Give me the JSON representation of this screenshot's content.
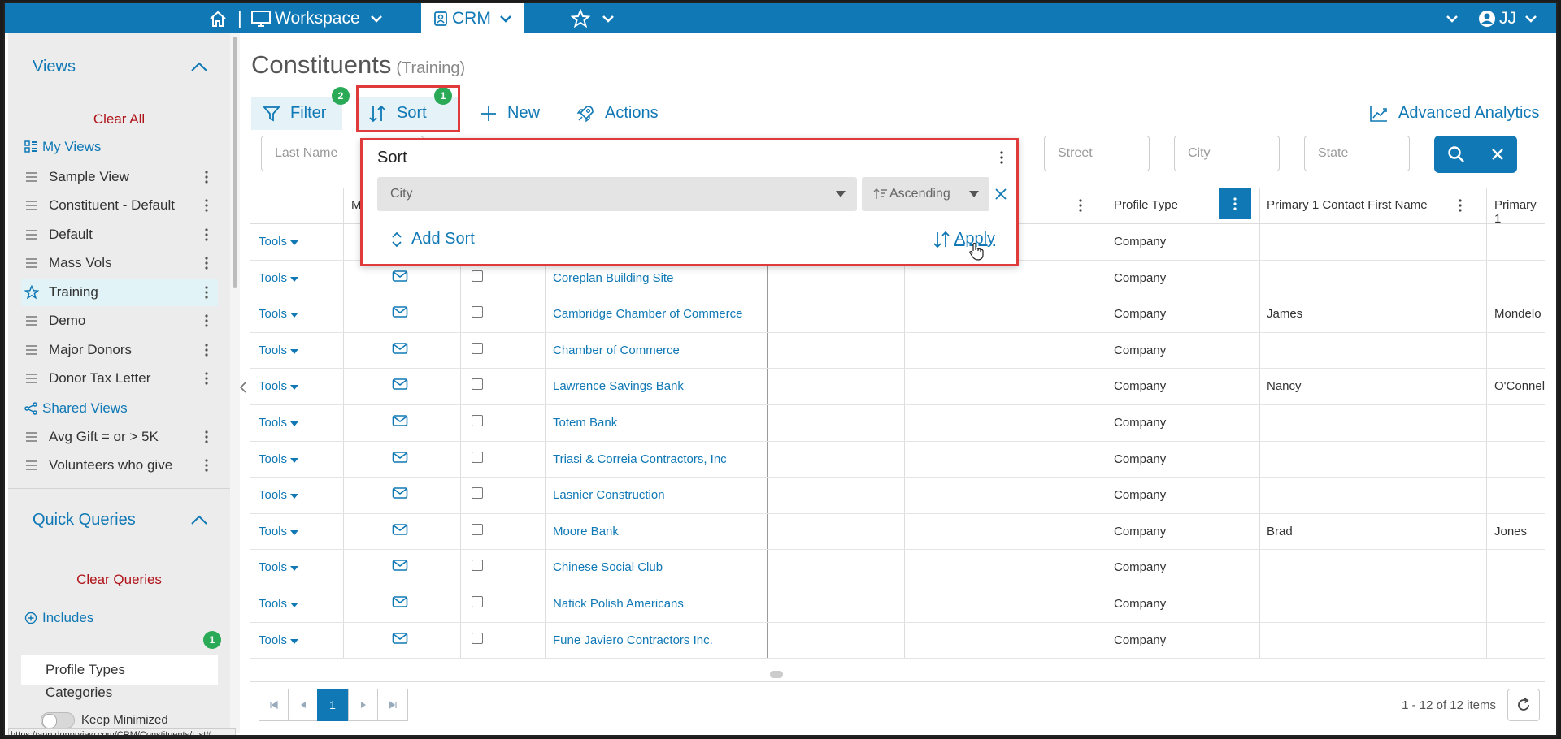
{
  "topbar": {
    "home_icon": "home-icon",
    "separator": "|",
    "workspace_label": "Workspace",
    "crm_label": "CRM",
    "user_label": "JJ"
  },
  "sidebar": {
    "views_title": "Views",
    "clear_all": "Clear All",
    "my_views": "My Views",
    "items": [
      {
        "label": "Sample View"
      },
      {
        "label": "Constituent - Default"
      },
      {
        "label": "Default"
      },
      {
        "label": "Mass Vols"
      },
      {
        "label": "Training"
      },
      {
        "label": "Demo"
      },
      {
        "label": "Major Donors"
      },
      {
        "label": "Donor Tax Letter"
      }
    ],
    "shared_views": "Shared Views",
    "shared_items": [
      {
        "label": "Avg Gift = or > 5K"
      },
      {
        "label": "Volunteers who give"
      }
    ],
    "quick_queries_title": "Quick Queries",
    "clear_queries": "Clear Queries",
    "includes": "Includes",
    "includes_badge": "1",
    "profile_types": "Profile Types",
    "categories": "Categories",
    "keep_minimized": "Keep Minimized"
  },
  "main": {
    "title": "Constituents",
    "subtitle": "(Training)",
    "toolbar": {
      "filter": "Filter",
      "filter_badge": "2",
      "sort": "Sort",
      "sort_badge": "1",
      "new": "New",
      "actions": "Actions",
      "advanced_analytics": "Advanced Analytics"
    },
    "search": {
      "last_name": "Last Name",
      "street": "Street",
      "city": "City",
      "state": "State"
    }
  },
  "sort_popup": {
    "title": "Sort",
    "field_value": "City",
    "direction_value": "Ascending",
    "add_sort": "Add Sort",
    "apply": "Apply"
  },
  "table": {
    "headers": {
      "m": "M",
      "profile_type": "Profile Type",
      "primary_contact_first": "Primary 1 Contact First Name",
      "primary_last": "Primary 1"
    },
    "rows": [
      {
        "tools": "Tools",
        "name": "",
        "type": "Company",
        "first": "",
        "last": ""
      },
      {
        "tools": "Tools",
        "name": "Coreplan Building Site",
        "type": "Company",
        "first": "",
        "last": ""
      },
      {
        "tools": "Tools",
        "name": "Cambridge Chamber of Commerce",
        "type": "Company",
        "first": "James",
        "last": "Mondelo"
      },
      {
        "tools": "Tools",
        "name": "Chamber of Commerce",
        "type": "Company",
        "first": "",
        "last": ""
      },
      {
        "tools": "Tools",
        "name": "Lawrence Savings Bank",
        "type": "Company",
        "first": "Nancy",
        "last": "O'Connel"
      },
      {
        "tools": "Tools",
        "name": "Totem Bank",
        "type": "Company",
        "first": "",
        "last": ""
      },
      {
        "tools": "Tools",
        "name": "Triasi & Correia Contractors, Inc",
        "type": "Company",
        "first": "",
        "last": ""
      },
      {
        "tools": "Tools",
        "name": "Lasnier Construction",
        "type": "Company",
        "first": "",
        "last": ""
      },
      {
        "tools": "Tools",
        "name": "Moore Bank",
        "type": "Company",
        "first": "Brad",
        "last": "Jones"
      },
      {
        "tools": "Tools",
        "name": "Chinese Social Club",
        "type": "Company",
        "first": "",
        "last": ""
      },
      {
        "tools": "Tools",
        "name": "Natick Polish Americans",
        "type": "Company",
        "first": "",
        "last": ""
      },
      {
        "tools": "Tools",
        "name": "Fune Javiero Contractors Inc.",
        "type": "Company",
        "first": "",
        "last": ""
      }
    ]
  },
  "pager": {
    "current_page": "1",
    "info": "1 - 12 of 12 items"
  },
  "statusbar": "https://app.donorview.com/CRM/Constituents/List#",
  "colors": {
    "accent": "#0f78b5",
    "highlight": "#e03b3b",
    "badge": "#2aaa57",
    "danger_link": "#b0141b"
  }
}
